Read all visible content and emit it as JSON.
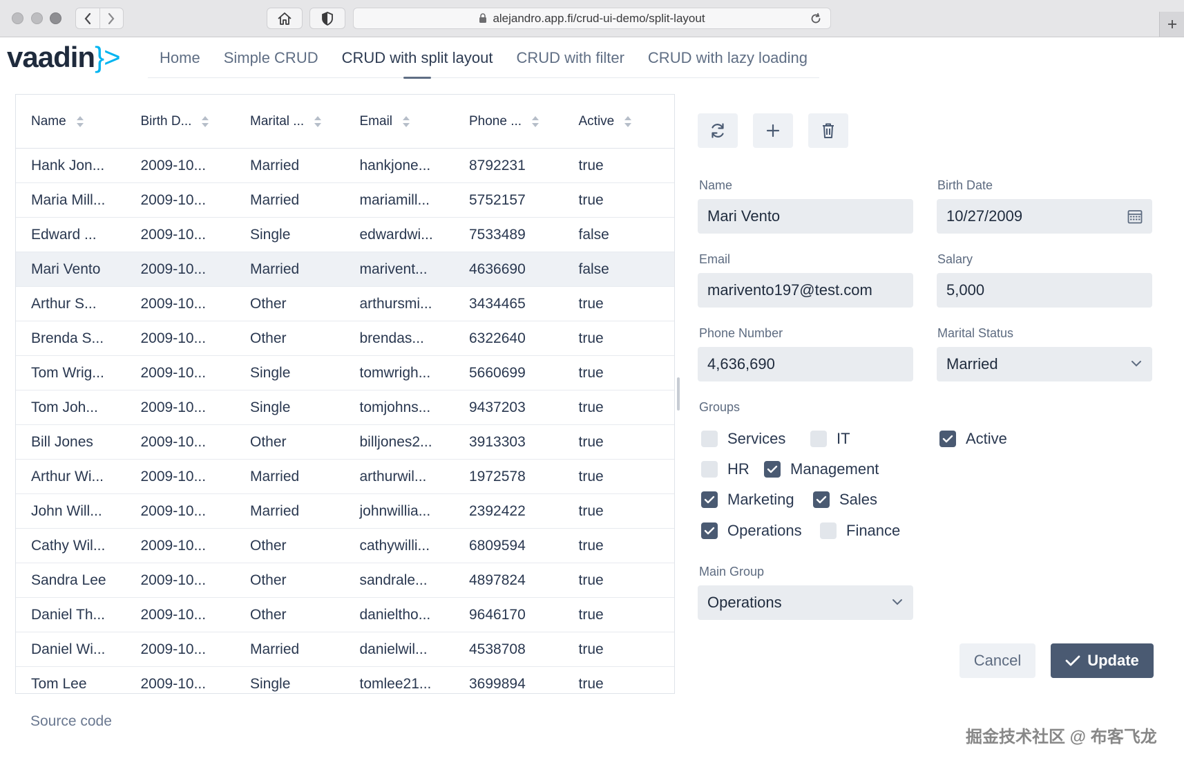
{
  "browser": {
    "url": "alejandro.app.fi/crud-ui-demo/split-layout"
  },
  "app": {
    "logo_text": "vaadin",
    "logo_bracket": "}>",
    "tabs": [
      {
        "label": "Home"
      },
      {
        "label": "Simple CRUD"
      },
      {
        "label": "CRUD with split layout",
        "active": true
      },
      {
        "label": "CRUD with filter"
      },
      {
        "label": "CRUD with lazy loading"
      }
    ]
  },
  "grid": {
    "columns": [
      "Name",
      "Birth D...",
      "Marital ...",
      "Email",
      "Phone ...",
      "Active"
    ],
    "rows": [
      [
        "Hank Jon...",
        "2009-10...",
        "Married",
        "hankjone...",
        "8792231",
        "true"
      ],
      [
        "Maria Mill...",
        "2009-10...",
        "Married",
        "mariamill...",
        "5752157",
        "true"
      ],
      [
        "Edward ...",
        "2009-10...",
        "Single",
        "edwardwi...",
        "7533489",
        "false"
      ],
      [
        "Mari Vento",
        "2009-10...",
        "Married",
        "marivent...",
        "4636690",
        "false"
      ],
      [
        "Arthur S...",
        "2009-10...",
        "Other",
        "arthursmi...",
        "3434465",
        "true"
      ],
      [
        "Brenda S...",
        "2009-10...",
        "Other",
        "brendas...",
        "6322640",
        "true"
      ],
      [
        "Tom Wrig...",
        "2009-10...",
        "Single",
        "tomwrigh...",
        "5660699",
        "true"
      ],
      [
        "Tom Joh...",
        "2009-10...",
        "Single",
        "tomjohns...",
        "9437203",
        "true"
      ],
      [
        "Bill Jones",
        "2009-10...",
        "Other",
        "billjones2...",
        "3913303",
        "true"
      ],
      [
        "Arthur Wi...",
        "2009-10...",
        "Married",
        "arthurwil...",
        "1972578",
        "true"
      ],
      [
        "John Will...",
        "2009-10...",
        "Married",
        "johnwillia...",
        "2392422",
        "true"
      ],
      [
        "Cathy Wil...",
        "2009-10...",
        "Other",
        "cathywilli...",
        "6809594",
        "true"
      ],
      [
        "Sandra Lee",
        "2009-10...",
        "Other",
        "sandrale...",
        "4897824",
        "true"
      ],
      [
        "Daniel Th...",
        "2009-10...",
        "Other",
        "danieltho...",
        "9646170",
        "true"
      ],
      [
        "Daniel Wi...",
        "2009-10...",
        "Married",
        "danielwil...",
        "4538708",
        "true"
      ],
      [
        "Tom Lee",
        "2009-10...",
        "Single",
        "tomlee21...",
        "3699894",
        "true"
      ]
    ],
    "selected_row": 3,
    "source_link": "Source code"
  },
  "form": {
    "name_label": "Name",
    "name_value": "Mari Vento",
    "birth_label": "Birth Date",
    "birth_value": "10/27/2009",
    "email_label": "Email",
    "email_value": "marivento197@test.com",
    "salary_label": "Salary",
    "salary_value": "5,000",
    "phone_label": "Phone Number",
    "phone_value": "4,636,690",
    "marital_label": "Marital Status",
    "marital_value": "Married",
    "groups_label": "Groups",
    "groups": [
      {
        "label": "Services",
        "checked": false
      },
      {
        "label": "IT",
        "checked": false
      },
      {
        "label": "HR",
        "checked": false
      },
      {
        "label": "Management",
        "checked": true
      },
      {
        "label": "Marketing",
        "checked": true
      },
      {
        "label": "Sales",
        "checked": true
      },
      {
        "label": "Operations",
        "checked": true
      },
      {
        "label": "Finance",
        "checked": false
      }
    ],
    "active_label": "Active",
    "active_checked": true,
    "main_group_label": "Main Group",
    "main_group_value": "Operations",
    "cancel_label": "Cancel",
    "update_label": "Update"
  },
  "watermark": "掘金技术社区 @ 布客飞龙",
  "colors": {
    "accent": "#4a5a72",
    "field_bg": "#e9ecf0",
    "selected_row": "#eef1f5"
  }
}
